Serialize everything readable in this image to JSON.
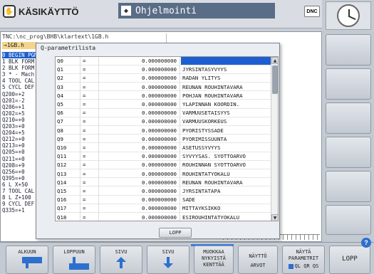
{
  "header": {
    "mode_left": "KÄSIKÄYTTÖ",
    "mode_right": "Ohjelmointi",
    "dnc_label": "DNC"
  },
  "program": {
    "path": "TNC:\\nc_prog\\BHB\\klartext\\1GB.h",
    "file_name": "→1GB.h",
    "lines": [
      "0  BEGIN PGM",
      "1  BLK FORM",
      "2  BLK FORM",
      "3  * - Mach",
      "4  TOOL CAL",
      "5  CYCL DEF",
      "   Q200=+2",
      "   Q201=-2",
      "   Q206=+1",
      "   Q202=+5",
      "   Q210=+0",
      "   Q203=+0",
      "   Q204=+5",
      "   Q212=+0",
      "   Q213=+0",
      "   Q205=+0",
      "   Q211=+0",
      "   Q208=+9",
      "   Q256=+0",
      "   Q395=+0",
      "6  L  X+50",
      "7  TOOL CAL",
      "8  L  Z+100",
      "9  CYCL DEF",
      "   Q335=+1"
    ]
  },
  "dialog": {
    "title": "Q-parametrilista",
    "close_label": "LOPP",
    "rows": [
      {
        "q": "Q0",
        "eq": "=",
        "val": "0.000000000",
        "desc": ""
      },
      {
        "q": "Q1",
        "eq": "=",
        "val": "0.000000000",
        "desc": "JYRSINTASYVYYS"
      },
      {
        "q": "Q2",
        "eq": "=",
        "val": "0.000000000",
        "desc": "RADAN YLITYS"
      },
      {
        "q": "Q3",
        "eq": "=",
        "val": "0.000000000",
        "desc": "REUNAN ROUHINTAVARA"
      },
      {
        "q": "Q4",
        "eq": "=",
        "val": "0.000000000",
        "desc": "POHJAN ROUHINTAVARA"
      },
      {
        "q": "Q5",
        "eq": "=",
        "val": "0.000000000",
        "desc": "YLAPINNAN KOORDIN."
      },
      {
        "q": "Q6",
        "eq": "=",
        "val": "0.000000000",
        "desc": "VARMUUSETAISYYS"
      },
      {
        "q": "Q7",
        "eq": "=",
        "val": "0.000000000",
        "desc": "VARMUUSKORKEUS"
      },
      {
        "q": "Q8",
        "eq": "=",
        "val": "0.000000000",
        "desc": "PYORISTYSSADE"
      },
      {
        "q": "Q9",
        "eq": "=",
        "val": "0.000000000",
        "desc": "PYORIMISSUUNTA"
      },
      {
        "q": "Q10",
        "eq": "=",
        "val": "0.000000000",
        "desc": "ASETUSSYVYYS"
      },
      {
        "q": "Q11",
        "eq": "=",
        "val": "0.000000000",
        "desc": "SYVYYSAS. SYOTTOARVO"
      },
      {
        "q": "Q12",
        "eq": "=",
        "val": "0.000000000",
        "desc": "ROUHINNAN SYOTTOARVO"
      },
      {
        "q": "Q13",
        "eq": "=",
        "val": "0.000000000",
        "desc": "ROUHINTATYOKALU"
      },
      {
        "q": "Q14",
        "eq": "=",
        "val": "0.000000000",
        "desc": "REUNAN ROUHINTAVARA"
      },
      {
        "q": "Q15",
        "eq": "=",
        "val": "0.000000000",
        "desc": "JYRSINTATAPA"
      },
      {
        "q": "Q16",
        "eq": "=",
        "val": "0.000000000",
        "desc": "SADE"
      },
      {
        "q": "Q17",
        "eq": "=",
        "val": "0.000000000",
        "desc": "MITTAYKSIKKO"
      },
      {
        "q": "Q18",
        "eq": "=",
        "val": "0.000000000",
        "desc": "ESIROUHINTATYOKALU"
      }
    ]
  },
  "softkeys": {
    "alkuun": "ALKUUN",
    "loppuun": "LOPPUUN",
    "sivu_up": "SIVU",
    "sivu_down": "SIVU",
    "muokkaa_1": "MUOKKAA",
    "muokkaa_2": "NYKYISTÄ",
    "muokkaa_3": "KENTTÄÄ",
    "nayta_1": "NÄYTTÖ",
    "nayta_2": "ARVOT",
    "naytapar_1": "NÄYTÄ",
    "naytapar_2": "PARAMETRIT",
    "naytapar_3": "QL QR QS",
    "lopp": "LOPP"
  }
}
